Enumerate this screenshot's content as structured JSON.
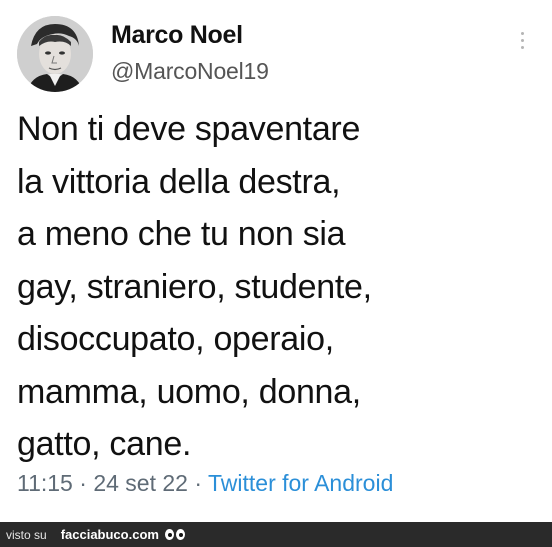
{
  "tweet": {
    "author": {
      "name": "Marco Noel",
      "handle": "@MarcoNoel19",
      "avatar_icon": "user-avatar"
    },
    "text_lines": [
      "Non ti deve spaventare",
      "la vittoria della destra,",
      "a meno che tu non sia",
      "gay, straniero, studente,",
      "disoccupato, operaio,",
      "mamma, uomo, donna,",
      "gatto, cane."
    ],
    "time": "11:15",
    "date": "24 set 22",
    "separator": "·",
    "source": "Twitter for Android",
    "more_icon": "more-vertical-icon"
  },
  "footer": {
    "prefix": "visto su",
    "brand": "facciabuco.com",
    "logo_icon": "eyes-icon",
    "background": "#2a2a2a"
  },
  "colors": {
    "text": "#111111",
    "handle": "#555555",
    "meta": "#5f6b76",
    "link": "#2b8fd8"
  }
}
